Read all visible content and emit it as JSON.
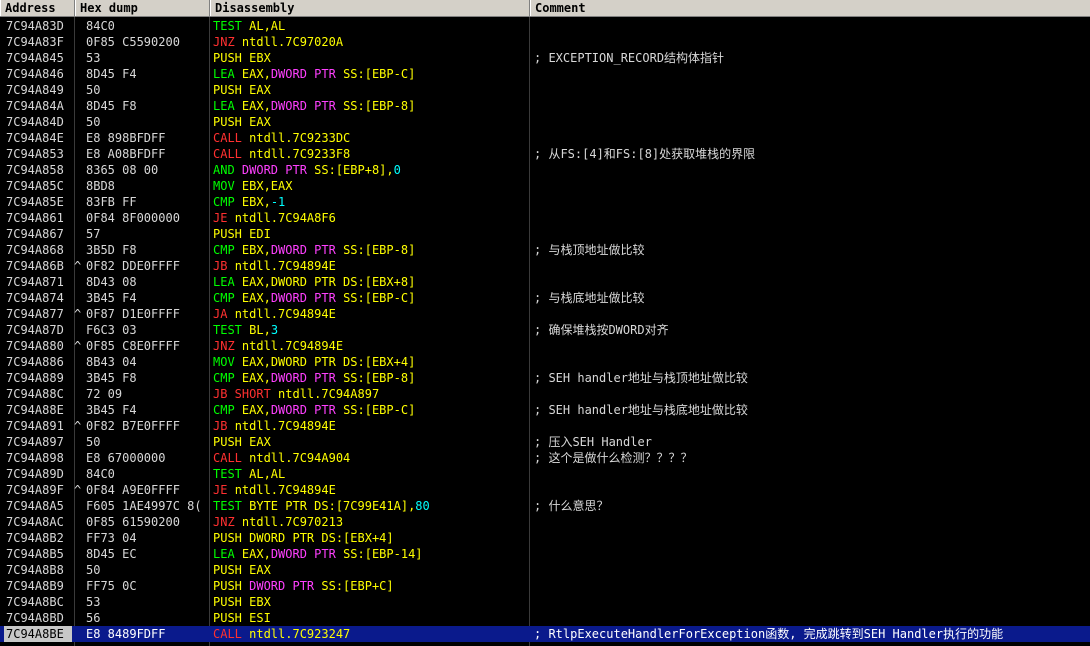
{
  "columns": {
    "address": "Address",
    "hex": "Hex dump",
    "disasm": "Disassembly",
    "comment": "Comment"
  },
  "colors": {
    "mnemonic_plain": "#00ff00",
    "mnemonic_jump": "#ff3030",
    "mnemonic_call": "#ff3030",
    "mnemonic_push": "#ffff00",
    "operand": "#ffff00",
    "size_ptr": "#ff40ff",
    "immediate": "#00ffff",
    "selected_bg": "#0a1a8c"
  },
  "rows": [
    {
      "addr": "7C94A83D",
      "mark": "",
      "hex": "84C0",
      "parts": [
        [
          "TEST ",
          "g"
        ],
        [
          "AL,AL",
          "y"
        ]
      ],
      "cmt": ""
    },
    {
      "addr": "7C94A83F",
      "mark": "",
      "hex": "0F85 C5590200",
      "parts": [
        [
          "JNZ ",
          "r"
        ],
        [
          "ntdll.7C97020A",
          "y"
        ]
      ],
      "cmt": ""
    },
    {
      "addr": "7C94A845",
      "mark": "",
      "hex": "53",
      "parts": [
        [
          "PUSH ",
          "y"
        ],
        [
          "EBX",
          "y"
        ]
      ],
      "cmt": "; EXCEPTION_RECORD结构体指针"
    },
    {
      "addr": "7C94A846",
      "mark": "",
      "hex": "8D45 F4",
      "parts": [
        [
          "LEA ",
          "g"
        ],
        [
          "EAX,",
          "y"
        ],
        [
          "DWORD PTR ",
          "m"
        ],
        [
          "SS:[EBP-C]",
          "y"
        ]
      ],
      "cmt": ""
    },
    {
      "addr": "7C94A849",
      "mark": "",
      "hex": "50",
      "parts": [
        [
          "PUSH ",
          "y"
        ],
        [
          "EAX",
          "y"
        ]
      ],
      "cmt": ""
    },
    {
      "addr": "7C94A84A",
      "mark": "",
      "hex": "8D45 F8",
      "parts": [
        [
          "LEA ",
          "g"
        ],
        [
          "EAX,",
          "y"
        ],
        [
          "DWORD PTR ",
          "m"
        ],
        [
          "SS:[EBP-8]",
          "y"
        ]
      ],
      "cmt": ""
    },
    {
      "addr": "7C94A84D",
      "mark": "",
      "hex": "50",
      "parts": [
        [
          "PUSH ",
          "y"
        ],
        [
          "EAX",
          "y"
        ]
      ],
      "cmt": ""
    },
    {
      "addr": "7C94A84E",
      "mark": "",
      "hex": "E8 898BFDFF",
      "parts": [
        [
          "CALL ",
          "r"
        ],
        [
          "ntdll.7C9233DC",
          "y"
        ]
      ],
      "cmt": ""
    },
    {
      "addr": "7C94A853",
      "mark": "",
      "hex": "E8 A08BFDFF",
      "parts": [
        [
          "CALL ",
          "r"
        ],
        [
          "ntdll.7C9233F8",
          "y"
        ]
      ],
      "cmt": "; 从FS:[4]和FS:[8]处获取堆栈的界限"
    },
    {
      "addr": "7C94A858",
      "mark": "",
      "hex": "8365 08 00",
      "parts": [
        [
          "AND ",
          "g"
        ],
        [
          "DWORD PTR ",
          "m"
        ],
        [
          "SS:[EBP+8],",
          "y"
        ],
        [
          "0",
          "c"
        ]
      ],
      "cmt": ""
    },
    {
      "addr": "7C94A85C",
      "mark": "",
      "hex": "8BD8",
      "parts": [
        [
          "MOV ",
          "g"
        ],
        [
          "EBX,EAX",
          "y"
        ]
      ],
      "cmt": ""
    },
    {
      "addr": "7C94A85E",
      "mark": "",
      "hex": "83FB FF",
      "parts": [
        [
          "CMP ",
          "g"
        ],
        [
          "EBX,",
          "y"
        ],
        [
          "-1",
          "c"
        ]
      ],
      "cmt": ""
    },
    {
      "addr": "7C94A861",
      "mark": "",
      "hex": "0F84 8F000000",
      "parts": [
        [
          "JE ",
          "r"
        ],
        [
          "ntdll.7C94A8F6",
          "y"
        ]
      ],
      "cmt": ""
    },
    {
      "addr": "7C94A867",
      "mark": "",
      "hex": "57",
      "parts": [
        [
          "PUSH ",
          "y"
        ],
        [
          "EDI",
          "y"
        ]
      ],
      "cmt": ""
    },
    {
      "addr": "7C94A868",
      "mark": "",
      "hex": "3B5D F8",
      "parts": [
        [
          "CMP ",
          "g"
        ],
        [
          "EBX,",
          "y"
        ],
        [
          "DWORD PTR ",
          "m"
        ],
        [
          "SS:[EBP-8]",
          "y"
        ]
      ],
      "cmt": "; 与栈顶地址做比较"
    },
    {
      "addr": "7C94A86B",
      "mark": "^",
      "hex": "0F82 DDE0FFFF",
      "parts": [
        [
          "JB ",
          "r"
        ],
        [
          "ntdll.7C94894E",
          "y"
        ]
      ],
      "cmt": ""
    },
    {
      "addr": "7C94A871",
      "mark": "",
      "hex": "8D43 08",
      "parts": [
        [
          "LEA ",
          "g"
        ],
        [
          "EAX,",
          "y"
        ],
        [
          "DWORD PTR DS:[EBX+8]",
          "y"
        ]
      ],
      "cmt": ""
    },
    {
      "addr": "7C94A874",
      "mark": "",
      "hex": "3B45 F4",
      "parts": [
        [
          "CMP ",
          "g"
        ],
        [
          "EAX,",
          "y"
        ],
        [
          "DWORD PTR ",
          "m"
        ],
        [
          "SS:[EBP-C]",
          "y"
        ]
      ],
      "cmt": "; 与栈底地址做比较"
    },
    {
      "addr": "7C94A877",
      "mark": "^",
      "hex": "0F87 D1E0FFFF",
      "parts": [
        [
          "JA ",
          "r"
        ],
        [
          "ntdll.7C94894E",
          "y"
        ]
      ],
      "cmt": ""
    },
    {
      "addr": "7C94A87D",
      "mark": "",
      "hex": "F6C3 03",
      "parts": [
        [
          "TEST ",
          "g"
        ],
        [
          "BL,",
          "y"
        ],
        [
          "3",
          "c"
        ]
      ],
      "cmt": "; 确保堆栈按DWORD对齐"
    },
    {
      "addr": "7C94A880",
      "mark": "^",
      "hex": "0F85 C8E0FFFF",
      "parts": [
        [
          "JNZ ",
          "r"
        ],
        [
          "ntdll.7C94894E",
          "y"
        ]
      ],
      "cmt": ""
    },
    {
      "addr": "7C94A886",
      "mark": "",
      "hex": "8B43 04",
      "parts": [
        [
          "MOV ",
          "g"
        ],
        [
          "EAX,",
          "y"
        ],
        [
          "DWORD PTR DS:[EBX+4]",
          "y"
        ]
      ],
      "cmt": ""
    },
    {
      "addr": "7C94A889",
      "mark": "",
      "hex": "3B45 F8",
      "parts": [
        [
          "CMP ",
          "g"
        ],
        [
          "EAX,",
          "y"
        ],
        [
          "DWORD PTR ",
          "m"
        ],
        [
          "SS:[EBP-8]",
          "y"
        ]
      ],
      "cmt": "; SEH handler地址与栈顶地址做比较"
    },
    {
      "addr": "7C94A88C",
      "mark": "",
      "hex": "72 09",
      "parts": [
        [
          "JB SHORT ",
          "r"
        ],
        [
          "ntdll.7C94A897",
          "y"
        ]
      ],
      "cmt": ""
    },
    {
      "addr": "7C94A88E",
      "mark": "",
      "hex": "3B45 F4",
      "parts": [
        [
          "CMP ",
          "g"
        ],
        [
          "EAX,",
          "y"
        ],
        [
          "DWORD PTR ",
          "m"
        ],
        [
          "SS:[EBP-C]",
          "y"
        ]
      ],
      "cmt": "; SEH handler地址与栈底地址做比较"
    },
    {
      "addr": "7C94A891",
      "mark": "^",
      "hex": "0F82 B7E0FFFF",
      "parts": [
        [
          "JB ",
          "r"
        ],
        [
          "ntdll.7C94894E",
          "y"
        ]
      ],
      "cmt": ""
    },
    {
      "addr": "7C94A897",
      "mark": "",
      "hex": "50",
      "parts": [
        [
          "PUSH ",
          "y"
        ],
        [
          "EAX",
          "y"
        ]
      ],
      "cmt": "; 压入SEH Handler"
    },
    {
      "addr": "7C94A898",
      "mark": "",
      "hex": "E8 67000000",
      "parts": [
        [
          "CALL ",
          "r"
        ],
        [
          "ntdll.7C94A904",
          "y"
        ]
      ],
      "cmt": "; 这个是做什么检测？？？？"
    },
    {
      "addr": "7C94A89D",
      "mark": "",
      "hex": "84C0",
      "parts": [
        [
          "TEST ",
          "g"
        ],
        [
          "AL,AL",
          "y"
        ]
      ],
      "cmt": ""
    },
    {
      "addr": "7C94A89F",
      "mark": "^",
      "hex": "0F84 A9E0FFFF",
      "parts": [
        [
          "JE ",
          "r"
        ],
        [
          "ntdll.7C94894E",
          "y"
        ]
      ],
      "cmt": ""
    },
    {
      "addr": "7C94A8A5",
      "mark": "",
      "hex": "F605 1AE4997C 8(",
      "parts": [
        [
          "TEST ",
          "g"
        ],
        [
          "BYTE PTR DS:[7C99E41A],",
          "y"
        ],
        [
          "80",
          "c"
        ]
      ],
      "cmt": "; 什么意思？"
    },
    {
      "addr": "7C94A8AC",
      "mark": "",
      "hex": "0F85 61590200",
      "parts": [
        [
          "JNZ ",
          "r"
        ],
        [
          "ntdll.7C970213",
          "y"
        ]
      ],
      "cmt": ""
    },
    {
      "addr": "7C94A8B2",
      "mark": "",
      "hex": "FF73 04",
      "parts": [
        [
          "PUSH ",
          "y"
        ],
        [
          "DWORD PTR DS:[EBX+4]",
          "y"
        ]
      ],
      "cmt": ""
    },
    {
      "addr": "7C94A8B5",
      "mark": "",
      "hex": "8D45 EC",
      "parts": [
        [
          "LEA ",
          "g"
        ],
        [
          "EAX,",
          "y"
        ],
        [
          "DWORD PTR ",
          "m"
        ],
        [
          "SS:[EBP-14]",
          "y"
        ]
      ],
      "cmt": ""
    },
    {
      "addr": "7C94A8B8",
      "mark": "",
      "hex": "50",
      "parts": [
        [
          "PUSH ",
          "y"
        ],
        [
          "EAX",
          "y"
        ]
      ],
      "cmt": ""
    },
    {
      "addr": "7C94A8B9",
      "mark": "",
      "hex": "FF75 0C",
      "parts": [
        [
          "PUSH ",
          "y"
        ],
        [
          "DWORD PTR ",
          "m"
        ],
        [
          "SS:[EBP+C]",
          "y"
        ]
      ],
      "cmt": ""
    },
    {
      "addr": "7C94A8BC",
      "mark": "",
      "hex": "53",
      "parts": [
        [
          "PUSH ",
          "y"
        ],
        [
          "EBX",
          "y"
        ]
      ],
      "cmt": ""
    },
    {
      "addr": "7C94A8BD",
      "mark": "",
      "hex": "56",
      "parts": [
        [
          "PUSH ",
          "y"
        ],
        [
          "ESI",
          "y"
        ]
      ],
      "cmt": ""
    },
    {
      "addr": "7C94A8BE",
      "mark": "",
      "hex": "E8 8489FDFF",
      "parts": [
        [
          "CALL ",
          "r"
        ],
        [
          "ntdll.7C923247",
          "y"
        ]
      ],
      "cmt": "; RtlpExecuteHandlerForException函数, 完成跳转到SEH Handler执行的功能",
      "selected": true
    }
  ]
}
